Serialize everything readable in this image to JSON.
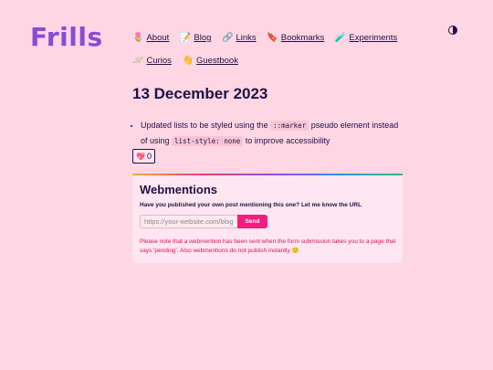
{
  "site": {
    "logo": "Frills",
    "theme_icon": "contrast-icon"
  },
  "nav": [
    {
      "icon": "🌷",
      "icon_name": "tulip-icon",
      "label": "About"
    },
    {
      "icon": "📝",
      "icon_name": "memo-icon",
      "label": "Blog"
    },
    {
      "icon": "🔗",
      "icon_name": "link-icon",
      "label": "Links"
    },
    {
      "icon": "🔖",
      "icon_name": "bookmark-icon",
      "label": "Bookmarks"
    },
    {
      "icon": "🧪",
      "icon_name": "test-tube-icon",
      "label": "Experiments"
    },
    {
      "icon": "🪐",
      "icon_name": "planet-icon",
      "label": "Curios"
    },
    {
      "icon": "👋",
      "icon_name": "wave-icon",
      "label": "Guestbook"
    }
  ],
  "post": {
    "title": "13 December 2023",
    "text_1": "Updated lists to be styled using the ",
    "code_1": "::marker",
    "text_2": " pseudo element instead of using ",
    "code_2": "list-style: none",
    "text_3": " to improve accessibility"
  },
  "like": {
    "icon": "💖",
    "count": "0"
  },
  "webmentions": {
    "title": "Webmentions",
    "prompt": "Have you published your own post mentioning this one? Let me know the URL",
    "placeholder": "https://your-website.com/blog",
    "send_label": "Send",
    "note": "Please note that a webmention has been sent when the form submission takes you to a page that says 'pending'. Also webmentions do not publish instantly 🙂"
  },
  "colors": {
    "background": "#ffd6e4",
    "logo": "#8b4ad6",
    "accent": "#ee1f7e",
    "note": "#d1195f"
  }
}
